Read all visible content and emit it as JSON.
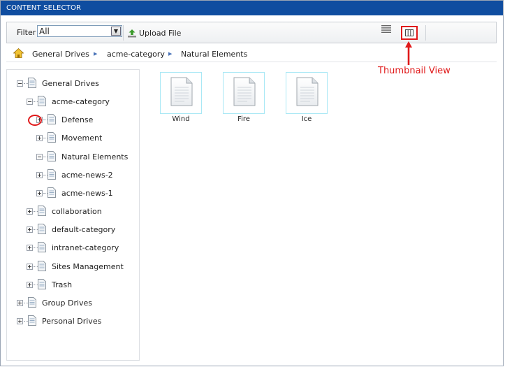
{
  "window": {
    "title": "CONTENT SELECTOR"
  },
  "toolbar": {
    "filter_label": "Filter",
    "filter_value": "All",
    "upload_label": "Upload File",
    "list_view_icon": "list-view-icon",
    "thumbnail_view_icon": "thumbnail-view-icon"
  },
  "breadcrumb": {
    "home_icon": "home-up-icon",
    "items": [
      "General Drives",
      "acme-category",
      "Natural Elements"
    ]
  },
  "tree": {
    "nodes": [
      {
        "label": "General Drives",
        "depth": 0,
        "expanded": true
      },
      {
        "label": "acme-category",
        "depth": 1,
        "expanded": true
      },
      {
        "label": "Defense",
        "depth": 2,
        "expanded": false
      },
      {
        "label": "Movement",
        "depth": 2,
        "expanded": false
      },
      {
        "label": "Natural Elements",
        "depth": 2,
        "expanded": true
      },
      {
        "label": "acme-news-2",
        "depth": 2,
        "expanded": false
      },
      {
        "label": "acme-news-1",
        "depth": 2,
        "expanded": false
      },
      {
        "label": "collaboration",
        "depth": 1,
        "expanded": false
      },
      {
        "label": "default-category",
        "depth": 1,
        "expanded": false
      },
      {
        "label": "intranet-category",
        "depth": 1,
        "expanded": false
      },
      {
        "label": "Sites Management",
        "depth": 1,
        "expanded": false
      },
      {
        "label": "Trash",
        "depth": 1,
        "expanded": false
      },
      {
        "label": "Group Drives",
        "depth": 0,
        "expanded": false
      },
      {
        "label": "Personal Drives",
        "depth": 0,
        "expanded": false
      }
    ]
  },
  "content": {
    "items": [
      {
        "label": "Wind",
        "icon": "document-icon"
      },
      {
        "label": "Fire",
        "icon": "document-icon"
      },
      {
        "label": "Ice",
        "icon": "document-icon"
      }
    ]
  },
  "annotation": {
    "label": "Thumbnail View",
    "color": "#e0191a"
  },
  "colors": {
    "titlebar": "#0f4da0",
    "thumb_border": "#a9e8f5",
    "annotation": "#e0191a"
  }
}
